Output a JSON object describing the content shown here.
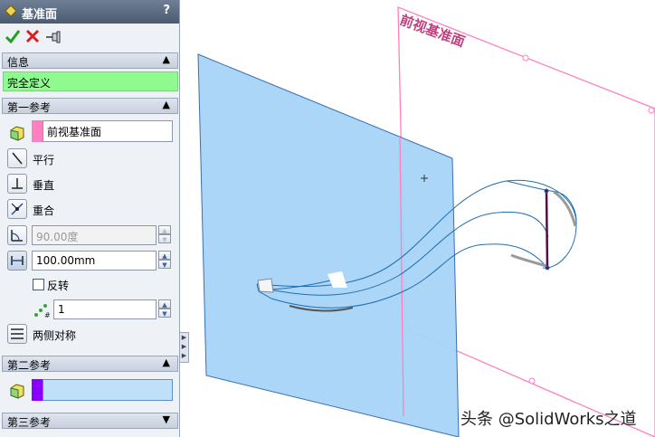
{
  "panel": {
    "title": "基准面",
    "help": "?",
    "actions": {
      "ok_icon": "check-icon",
      "cancel_icon": "x-icon",
      "pin_icon": "pushpin-icon"
    },
    "info": {
      "label": "信息",
      "status": "完全定义",
      "status_color": "#8ffb8f"
    },
    "first_ref": {
      "label": "第一参考",
      "selection": "前视基准面",
      "selection_color": "#ff80c0",
      "parallel": "平行",
      "perpendicular": "垂直",
      "coincident": "重合",
      "angle_value": "90.00度",
      "distance_value": "100.00mm",
      "flip": "反转",
      "count_value": "1",
      "midplane": "两侧对称"
    },
    "second_ref": {
      "label": "第二参考",
      "selection": "",
      "selection_color": "#8a00ff"
    },
    "third_ref": {
      "label": "第三参考"
    }
  },
  "viewport": {
    "plane_label": "前视基准面",
    "plane_fill": "#a8d4f8",
    "plane_outline": "#ff80c0",
    "model_color": "#1f6fae"
  },
  "watermark": "头条 @SolidWorks之道"
}
